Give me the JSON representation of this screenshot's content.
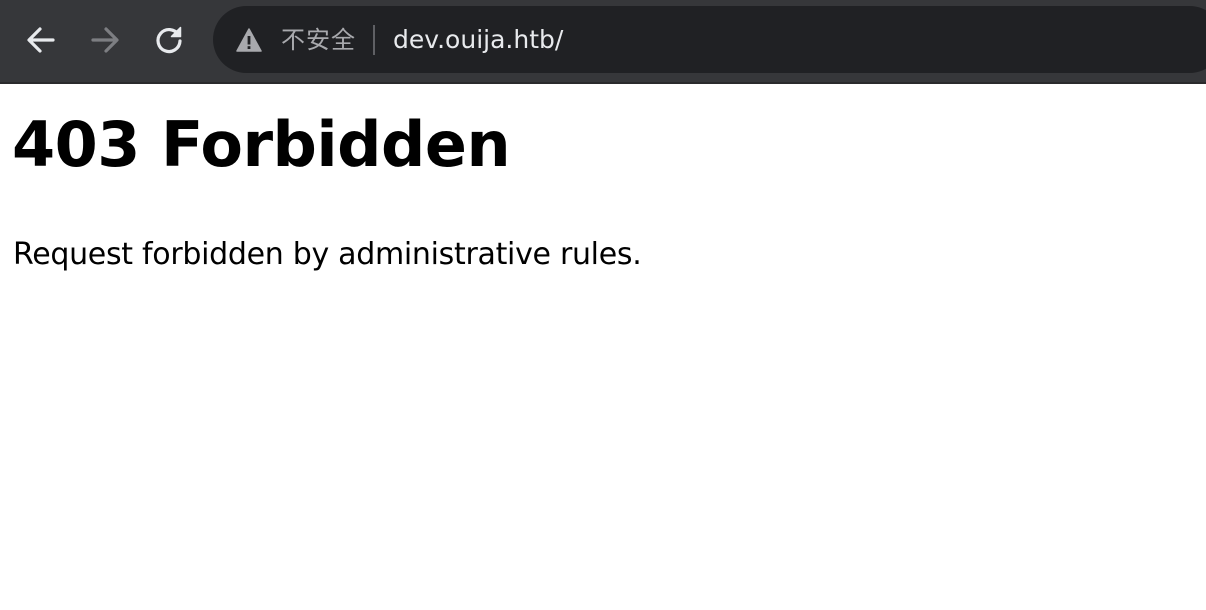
{
  "browser": {
    "back_icon": "arrow-left-icon",
    "forward_icon": "arrow-right-icon",
    "reload_icon": "reload-icon",
    "security_icon": "warning-triangle-icon",
    "security_label": "不安全",
    "url": "dev.ouija.htb/",
    "colors": {
      "toolbar": "#36373a",
      "omnibox": "#202124",
      "url_text": "#e8eaed",
      "security_text": "#a8a9ad",
      "forward_disabled": "#7d7e82"
    }
  },
  "page": {
    "heading": "403 Forbidden",
    "message": "Request forbidden by administrative rules."
  }
}
